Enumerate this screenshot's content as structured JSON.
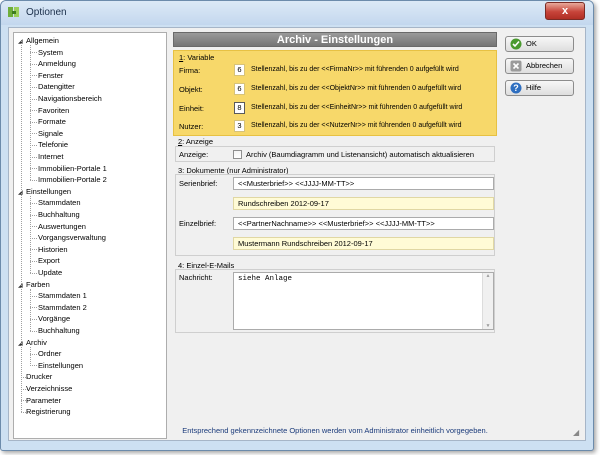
{
  "window": {
    "title": "Optionen",
    "close_label": "x"
  },
  "tree": [
    {
      "label": "Allgemein",
      "level": 0,
      "expander": "◢"
    },
    {
      "label": "System",
      "level": 1
    },
    {
      "label": "Anmeldung",
      "level": 1
    },
    {
      "label": "Fenster",
      "level": 1
    },
    {
      "label": "Datengitter",
      "level": 1
    },
    {
      "label": "Navigationsbereich",
      "level": 1
    },
    {
      "label": "Favoriten",
      "level": 1
    },
    {
      "label": "Formate",
      "level": 1
    },
    {
      "label": "Signale",
      "level": 1
    },
    {
      "label": "Telefonie",
      "level": 1
    },
    {
      "label": "Internet",
      "level": 1
    },
    {
      "label": "Immobilien-Portale 1",
      "level": 1
    },
    {
      "label": "Immobilien-Portale 2",
      "level": 1
    },
    {
      "label": "Einstellungen",
      "level": 0,
      "expander": "◢"
    },
    {
      "label": "Stammdaten",
      "level": 1
    },
    {
      "label": "Buchhaltung",
      "level": 1
    },
    {
      "label": "Auswertungen",
      "level": 1
    },
    {
      "label": "Vorgangsverwaltung",
      "level": 1
    },
    {
      "label": "Historien",
      "level": 1
    },
    {
      "label": "Export",
      "level": 1
    },
    {
      "label": "Update",
      "level": 1
    },
    {
      "label": "Farben",
      "level": 0,
      "expander": "◢"
    },
    {
      "label": "Stammdaten 1",
      "level": 1
    },
    {
      "label": "Stammdaten 2",
      "level": 1
    },
    {
      "label": "Vorgänge",
      "level": 1
    },
    {
      "label": "Buchhaltung",
      "level": 1
    },
    {
      "label": "Archiv",
      "level": 0,
      "expander": "◢"
    },
    {
      "label": "Ordner",
      "level": 1
    },
    {
      "label": "Einstellungen",
      "level": 1
    },
    {
      "label": "Drucker",
      "level": 0
    },
    {
      "label": "Verzeichnisse",
      "level": 0
    },
    {
      "label": "Parameter",
      "level": 0
    },
    {
      "label": "Registrierung",
      "level": 0
    }
  ],
  "header": {
    "title": "Archiv - Einstellungen"
  },
  "variable": {
    "num": "1",
    "title": ": Variable",
    "rows": [
      {
        "label": "Firma:",
        "value": "6",
        "desc": "Stellenzahl, bis zu der <<FirmaNr>> mit führenden 0 aufgefüllt wird"
      },
      {
        "label": "Objekt:",
        "value": "6",
        "desc": "Stellenzahl, bis zu der <<ObjektNr>> mit führenden 0 aufgefüllt wird"
      },
      {
        "label": "Einheit:",
        "value": "8",
        "desc": "Stellenzahl, bis zu der <<EinheitNr>> mit führenden 0 aufgefüllt wird"
      },
      {
        "label": "Nutzer:",
        "value": "3",
        "desc": "Stellenzahl, bis zu der <<NutzerNr>> mit führenden 0 aufgefüllt wird"
      }
    ]
  },
  "anzeige": {
    "num": "2",
    "title": ": Anzeige",
    "label": "Anzeige:",
    "checkbox_label": "Archiv (Baumdiagramm und Listenansicht) automatisch aktualisieren"
  },
  "dokumente": {
    "num": "3",
    "title": ": Dokumente  (nur Administrator)",
    "serien_label": "Serienbrief:",
    "serien_value": "<<Musterbrief>> <<JJJJ-MM-TT>>",
    "serien_preview": "Rundschreiben 2012-09-17",
    "einzel_label": "Einzelbrief:",
    "einzel_value": "<<PartnerNachname>> <<Musterbrief>> <<JJJJ-MM-TT>>",
    "einzel_preview": "Mustermann Rundschreiben 2012-09-17"
  },
  "email": {
    "num": "4",
    "title": ": Einzel-E-Mails",
    "label": "Nachricht:",
    "value": "siehe Anlage"
  },
  "footer": {
    "note": "Entsprechend gekennzeichnete Optionen werden vom Administrator einheitlich vorgegeben."
  },
  "buttons": {
    "ok": "OK",
    "cancel": "Abbrechen",
    "help": "Hilfe"
  }
}
